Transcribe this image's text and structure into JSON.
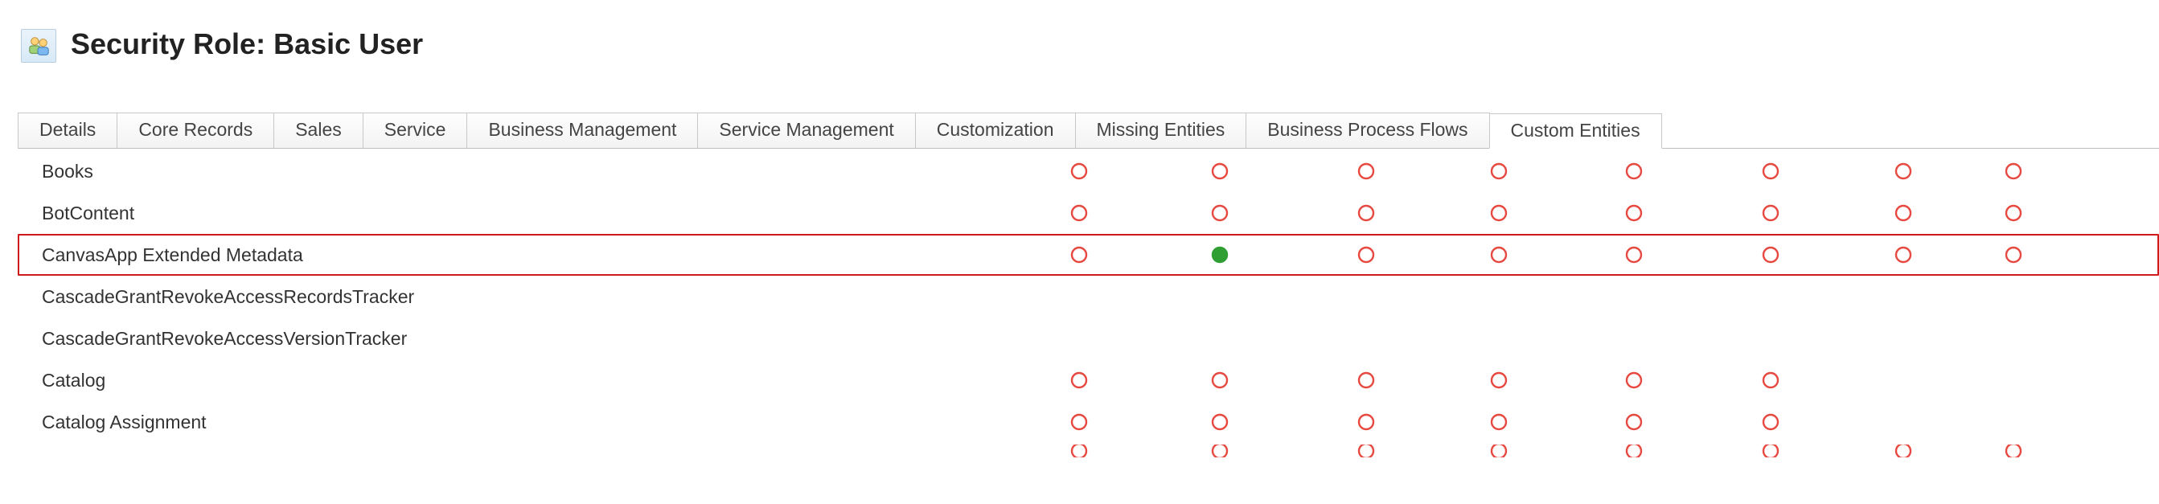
{
  "header": {
    "title": "Security Role: Basic User",
    "icon_name": "security-role-icon"
  },
  "tabs": [
    {
      "id": "details",
      "label": "Details",
      "active": false
    },
    {
      "id": "core",
      "label": "Core Records",
      "active": false
    },
    {
      "id": "sales",
      "label": "Sales",
      "active": false
    },
    {
      "id": "service",
      "label": "Service",
      "active": false
    },
    {
      "id": "bizmgmt",
      "label": "Business Management",
      "active": false
    },
    {
      "id": "svcmgmt",
      "label": "Service Management",
      "active": false
    },
    {
      "id": "custom",
      "label": "Customization",
      "active": false
    },
    {
      "id": "missing",
      "label": "Missing Entities",
      "active": false
    },
    {
      "id": "bpf",
      "label": "Business Process Flows",
      "active": false
    },
    {
      "id": "custent",
      "label": "Custom Entities",
      "active": true
    }
  ],
  "privilege_states": {
    "none": {
      "color": "#e74840",
      "fill": "none"
    },
    "full": {
      "color": "#2f9e33",
      "fill": "#2f9e33"
    },
    "hidden": {
      "color": "",
      "fill": ""
    }
  },
  "rows": [
    {
      "entity": "Books",
      "highlight": false,
      "cells": [
        "none",
        "none",
        "none",
        "none",
        "none",
        "none",
        "none",
        "none"
      ]
    },
    {
      "entity": "BotContent",
      "highlight": false,
      "cells": [
        "none",
        "none",
        "none",
        "none",
        "none",
        "none",
        "none",
        "none"
      ]
    },
    {
      "entity": "CanvasApp Extended Metadata",
      "highlight": true,
      "cells": [
        "none",
        "full",
        "none",
        "none",
        "none",
        "none",
        "none",
        "none"
      ]
    },
    {
      "entity": "CascadeGrantRevokeAccessRecordsTracker",
      "highlight": false,
      "cells": [
        "hidden",
        "hidden",
        "hidden",
        "hidden",
        "hidden",
        "hidden",
        "hidden",
        "hidden"
      ]
    },
    {
      "entity": "CascadeGrantRevokeAccessVersionTracker",
      "highlight": false,
      "cells": [
        "hidden",
        "hidden",
        "hidden",
        "hidden",
        "hidden",
        "hidden",
        "hidden",
        "hidden"
      ]
    },
    {
      "entity": "Catalog",
      "highlight": false,
      "cells": [
        "none",
        "none",
        "none",
        "none",
        "none",
        "none",
        "hidden",
        "hidden"
      ]
    },
    {
      "entity": "Catalog Assignment",
      "highlight": false,
      "cells": [
        "none",
        "none",
        "none",
        "none",
        "none",
        "none",
        "hidden",
        "hidden"
      ]
    }
  ],
  "partial_next_row_cells": [
    "none",
    "none",
    "none",
    "none",
    "none",
    "none",
    "none",
    "none"
  ]
}
